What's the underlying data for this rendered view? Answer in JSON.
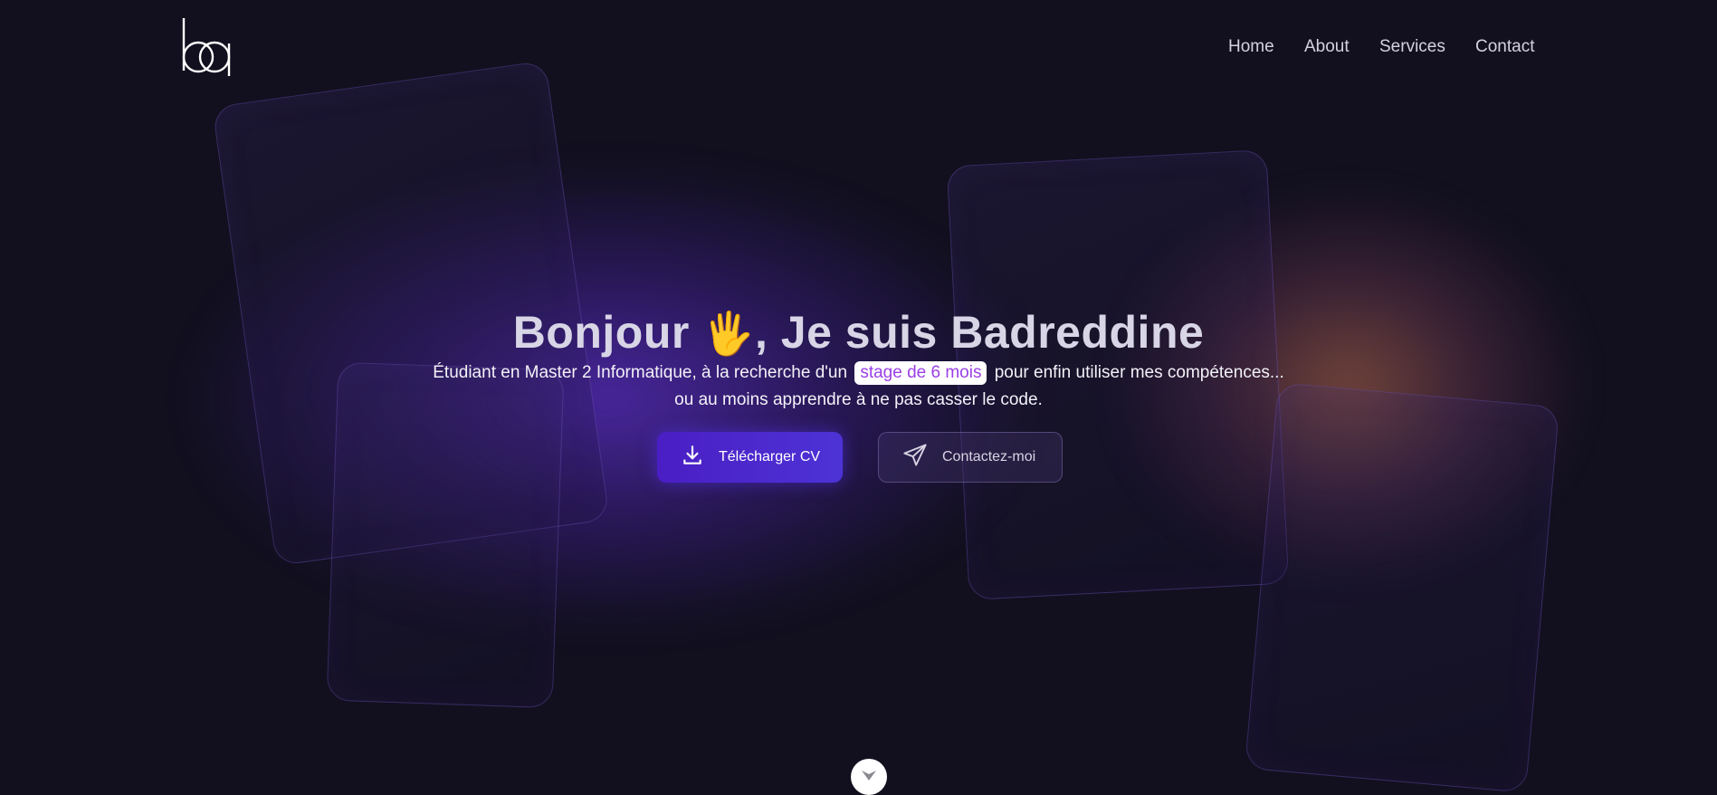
{
  "nav": {
    "logo_text": "ba",
    "items": [
      {
        "label": "Home"
      },
      {
        "label": "About"
      },
      {
        "label": "Services"
      },
      {
        "label": "Contact"
      }
    ]
  },
  "hero": {
    "title_part1": "Bonjour",
    "title_emoji": "🖐",
    "title_part2": ", Je suis Badreddine",
    "line1_before": "Étudiant en Master 2 Informatique, à la recherche d'un",
    "line1_highlight": "stage de 6 mois",
    "line1_after": "pour enfin utiliser mes compétences...",
    "line2": "ou au moins apprendre à ne pas casser le code."
  },
  "buttons": {
    "download_cv": {
      "label": "Télécharger CV",
      "icon": "download-icon"
    },
    "contact": {
      "label": "Contactez-moi",
      "icon": "send-icon"
    }
  },
  "scroll": {
    "icon": "chevron-down-icon"
  },
  "colors": {
    "background": "#12101f",
    "accent_purple": "#4a1ec4",
    "highlight_text": "#9b3fe6",
    "nav_text": "#d4d2de"
  }
}
